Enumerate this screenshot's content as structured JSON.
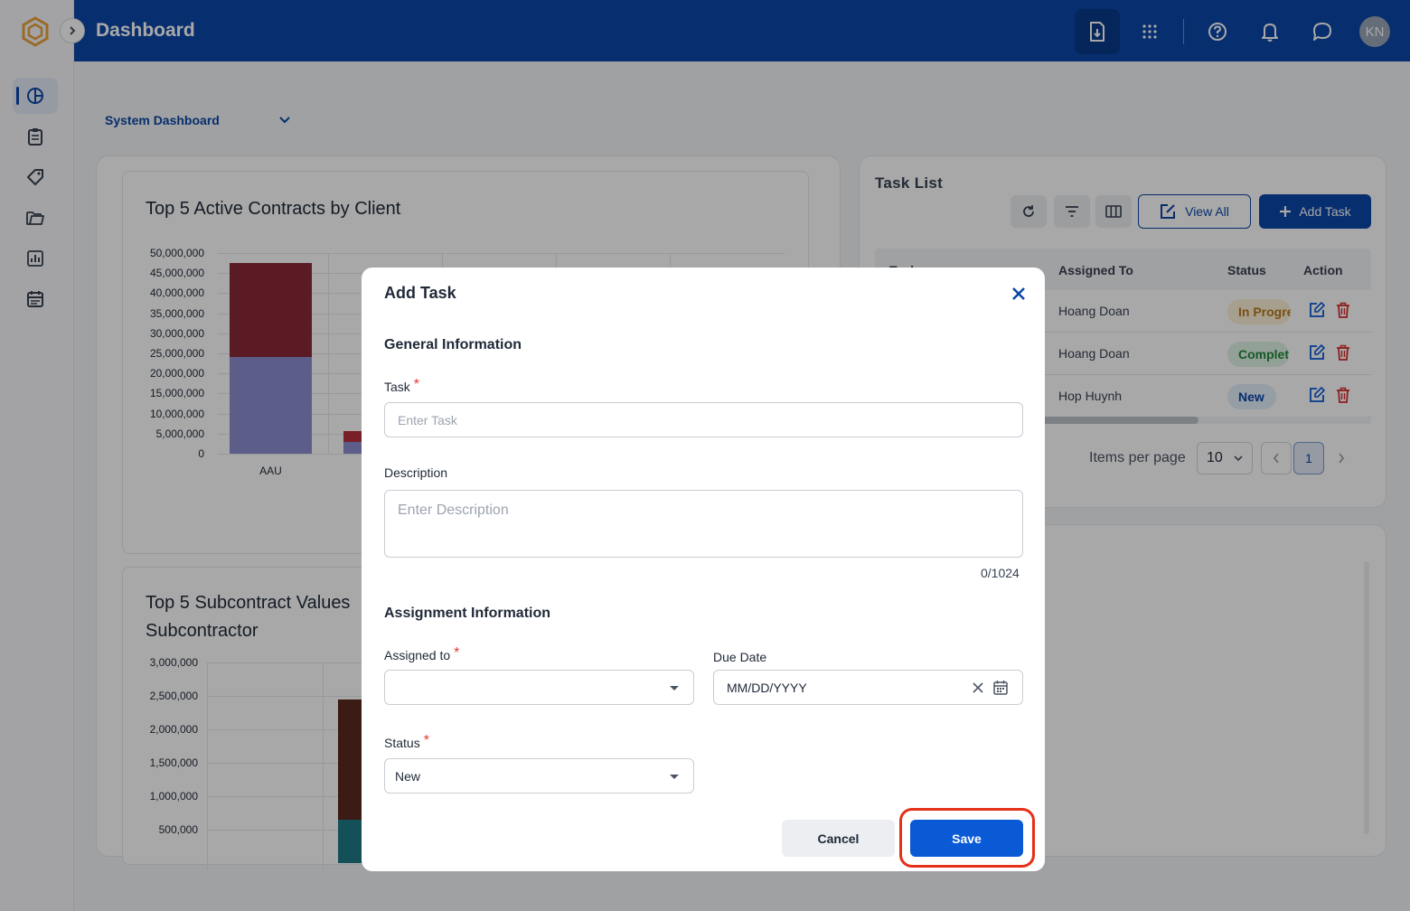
{
  "header": {
    "title": "Dashboard",
    "avatar_initials": "KN"
  },
  "sidebar": {
    "items": [
      {
        "name": "dashboard",
        "icon": "pie-chart-icon"
      },
      {
        "name": "contracts",
        "icon": "clipboard-icon"
      },
      {
        "name": "tags",
        "icon": "tag-icon"
      },
      {
        "name": "documents",
        "icon": "folder-icon"
      },
      {
        "name": "reports",
        "icon": "bar-chart-icon"
      },
      {
        "name": "calendar",
        "icon": "calendar-icon"
      }
    ]
  },
  "dashboard_selector": {
    "label": "System Dashboard"
  },
  "chart1": {
    "title": "Top 5 Active Contracts by Client",
    "y_ticks": [
      "50,000,000",
      "45,000,000",
      "40,000,000",
      "35,000,000",
      "30,000,000",
      "25,000,000",
      "20,000,000",
      "15,000,000",
      "10,000,000",
      "5,000,000",
      "0"
    ],
    "x_label_first": "AAU"
  },
  "chart2": {
    "title_line1": "Top 5 Subcontract Values",
    "title_line2": "Subcontractor",
    "y_ticks": [
      "3,000,000",
      "2,500,000",
      "2,000,000",
      "1,500,000",
      "1,000,000",
      "500,000"
    ]
  },
  "chart_data": [
    {
      "type": "bar",
      "title": "Top 5 Active Contracts by Client",
      "categories": [
        "AAU"
      ],
      "series": [
        {
          "values": [
            24000000
          ],
          "color": "#8c8ecf"
        },
        {
          "values": [
            23500000
          ],
          "color": "#8a2a38"
        }
      ],
      "ylim": [
        0,
        50000000
      ],
      "stacked": true
    },
    {
      "type": "bar",
      "title": "Top 5 Subcontract Values by Subcontractor",
      "series": [
        {
          "values": [
            650000
          ],
          "color": "#1e7a86"
        },
        {
          "values": [
            1800000
          ],
          "color": "#5a2a1e"
        }
      ],
      "ylim": [
        0,
        3000000
      ],
      "stacked": true
    }
  ],
  "task_list": {
    "title": "Task List",
    "view_all_label": "View All",
    "add_task_label": "Add Task",
    "columns": [
      "Task",
      "Assigned To",
      "Status",
      "Action"
    ],
    "rows": [
      {
        "assigned_to": "Hoang Doan",
        "status": "In Progress"
      },
      {
        "assigned_to": "Hoang Doan",
        "status": "Complete"
      },
      {
        "assigned_to": "Hop Huynh",
        "status": "New"
      }
    ],
    "items_per_page_label": "Items per page",
    "items_per_page_value": "10",
    "current_page": "1"
  },
  "modal": {
    "title": "Add Task",
    "general_section": "General Information",
    "task_label": "Task",
    "task_placeholder": "Enter Task",
    "description_label": "Description",
    "description_placeholder": "Enter Description",
    "char_counter": "0/1024",
    "assignment_section": "Assignment Information",
    "assigned_to_label": "Assigned to",
    "assigned_to_value": "",
    "due_date_label": "Due Date",
    "due_date_placeholder": "MM/DD/YYYY",
    "status_label": "Status",
    "status_value": "New",
    "required_mark": "*",
    "cancel_label": "Cancel",
    "save_label": "Save"
  },
  "colors": {
    "brand": "#0b47a8",
    "save_button": "#0a5ad6",
    "highlight": "#e63019",
    "required": "#e53935"
  }
}
